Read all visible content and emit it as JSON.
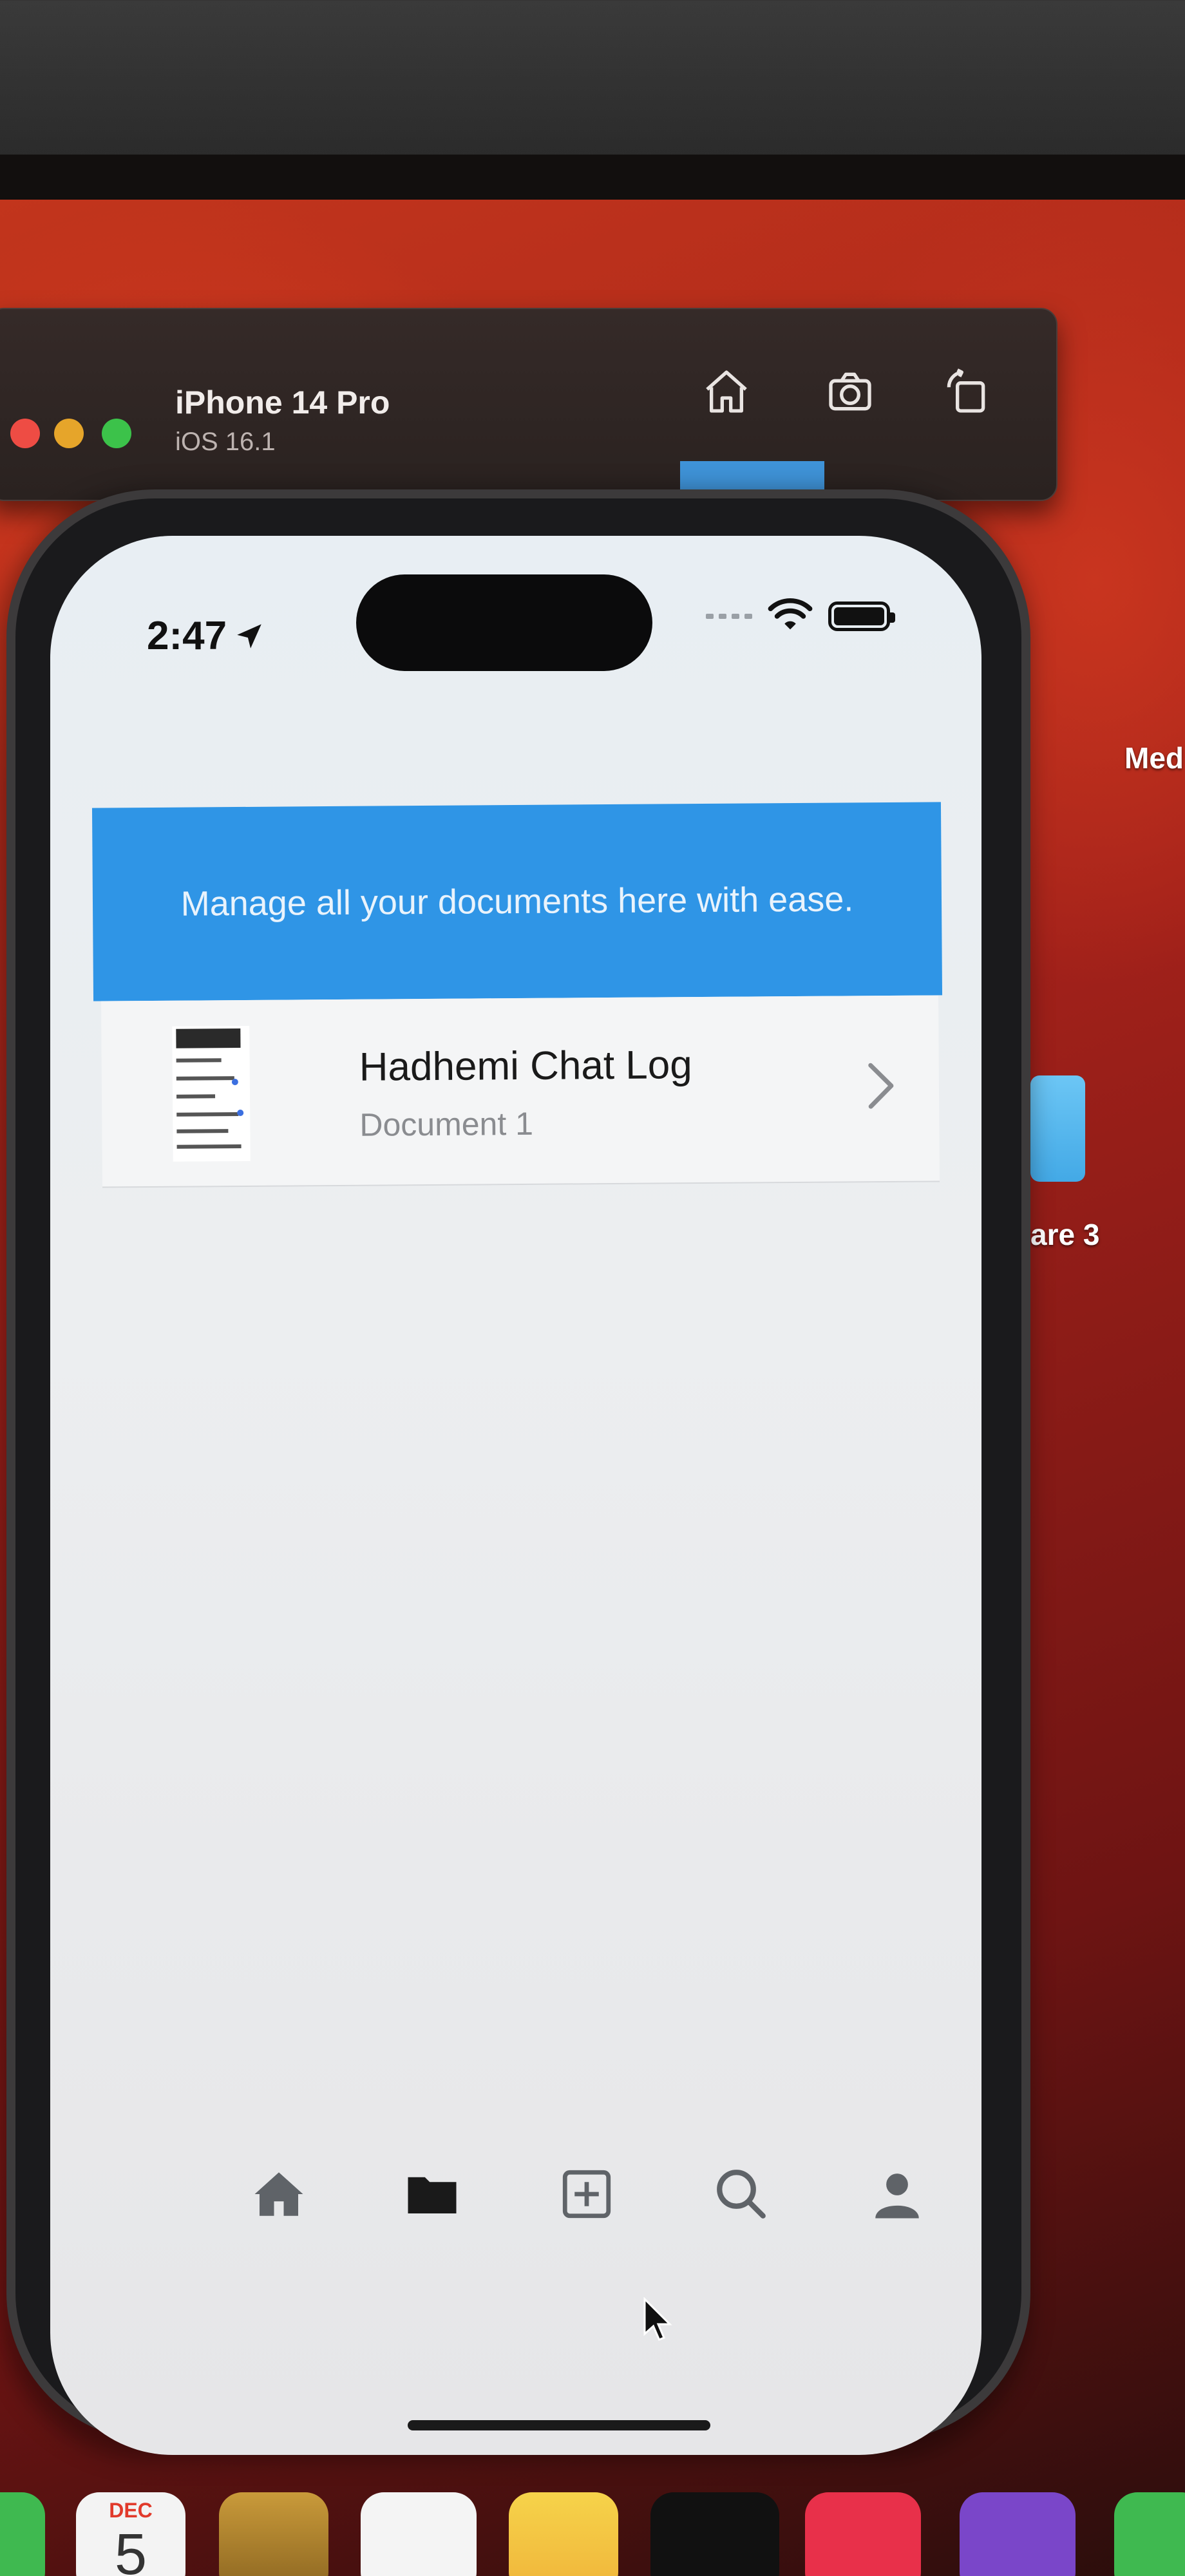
{
  "simulator": {
    "device_name": "iPhone 14 Pro",
    "os_version": "iOS 16.1",
    "buttons": {
      "home_icon": "home-icon",
      "screenshot_icon": "camera-icon",
      "rotate_icon": "rotate-icon"
    }
  },
  "desktop": {
    "label_top": "Med",
    "label_folder": "are 3"
  },
  "status_bar": {
    "time": "2:47",
    "location_icon": "location-arrow-icon",
    "wifi_icon": "wifi-icon",
    "battery_icon": "battery-icon"
  },
  "banner": {
    "text": "Manage all your documents here with ease."
  },
  "documents": [
    {
      "title": "Hadhemi Chat Log",
      "subtitle": "Document 1"
    }
  ],
  "tab_bar": [
    {
      "name": "home",
      "icon": "home-icon"
    },
    {
      "name": "documents",
      "icon": "folder-icon"
    },
    {
      "name": "add",
      "icon": "plus-square-icon"
    },
    {
      "name": "search",
      "icon": "search-icon"
    },
    {
      "name": "profile",
      "icon": "person-icon"
    }
  ],
  "dock": {
    "calendar_month": "DEC",
    "calendar_day": "5"
  },
  "colors": {
    "banner": "#2f95e6",
    "wallpaper": "#b6241b"
  }
}
